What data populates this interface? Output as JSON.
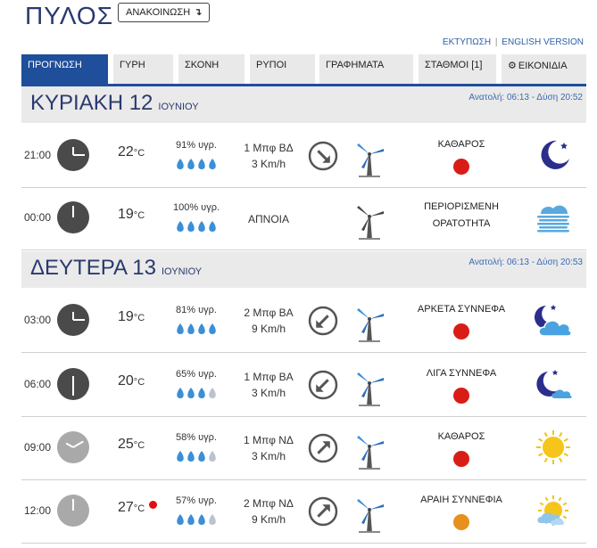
{
  "header": {
    "title": "ΠΥΛΟΣ",
    "announcement": "ΑΝΑΚΟΙΝΩΣΗ",
    "print_link": "ΕΚΤΥΠΩΣΗ",
    "separator": "|",
    "english_link": "ENGLISH VERSION"
  },
  "tabs": [
    "ΠΡΟΓΝΩΣΗ",
    "ΓΥΡΗ",
    "ΣΚΟΝΗ",
    "ΡΥΠΟΙ",
    "ΓΡΑΦΗΜΑΤΑ",
    "ΣΤΑΘΜΟΙ [1]",
    "ΕΙΚΟΝΙΔΙΑ"
  ],
  "days": [
    {
      "name": "ΚΥΡΙΑΚΗ 12",
      "month": "ΙΟΥΝΙΟΥ",
      "sun": "Ανατολή: 06:13  - Δύση 20:52"
    },
    {
      "name": "ΔΕΥΤΕΡΑ 13",
      "month": "ΙΟΥΝΙΟΥ",
      "sun": "Ανατολή: 06:13  - Δύση 20:53"
    }
  ],
  "rows": [
    {
      "time": "21:00",
      "temp": "22",
      "unit": "°C",
      "hum": "91% υγρ.",
      "drops": 4,
      "wind1": "1 Μπφ ΒΔ",
      "wind2": "3 Km/h",
      "dir": 135,
      "cond1": "ΚΑΘΑΡΟΣ",
      "cond2": "",
      "bug": "red",
      "icon": "moon-icon"
    },
    {
      "time": "00:00",
      "temp": "19",
      "unit": "°C",
      "hum": "100% υγρ.",
      "drops": 4,
      "wind1": "ΑΠΝΟΙΑ",
      "wind2": "",
      "dir": null,
      "cond1": "ΠΕΡΙΟΡΙΣΜΕΝΗ",
      "cond2": "ΟΡΑΤΟΤΗΤΑ",
      "bug": "",
      "icon": "fog-icon"
    },
    {
      "time": "03:00",
      "temp": "19",
      "unit": "°C",
      "hum": "81% υγρ.",
      "drops": 4,
      "wind1": "2 Μπφ ΒΑ",
      "wind2": "9 Km/h",
      "dir": 225,
      "cond1": "ΑΡΚΕΤΑ ΣΥΝΝΕΦΑ",
      "cond2": "",
      "bug": "red",
      "icon": "moon-cloud-icon"
    },
    {
      "time": "06:00",
      "temp": "20",
      "unit": "°C",
      "hum": "65% υγρ.",
      "drops": 3,
      "wind1": "1 Μπφ ΒΑ",
      "wind2": "3 Km/h",
      "dir": 225,
      "cond1": "ΛΙΓΑ ΣΥΝΝΕΦΑ",
      "cond2": "",
      "bug": "red",
      "icon": "moon-small-cloud-icon"
    },
    {
      "time": "09:00",
      "temp": "25",
      "unit": "°C",
      "hum": "58% υγρ.",
      "drops": 3,
      "wind1": "1 Μπφ ΝΔ",
      "wind2": "3 Km/h",
      "dir": 45,
      "cond1": "ΚΑΘΑΡΟΣ",
      "cond2": "",
      "bug": "red",
      "icon": "sun-icon"
    },
    {
      "time": "12:00",
      "temp": "27",
      "unit": "°C",
      "hum": "57% υγρ.",
      "drops": 3,
      "wind1": "2 Μπφ ΝΔ",
      "wind2": "9 Km/h",
      "dir": 45,
      "cond1": "ΑΡΑΙΗ ΣΥΝΝΕΦΙΑ",
      "cond2": "",
      "bug": "orange",
      "icon": "sun-cloud-icon",
      "hot": true
    }
  ]
}
